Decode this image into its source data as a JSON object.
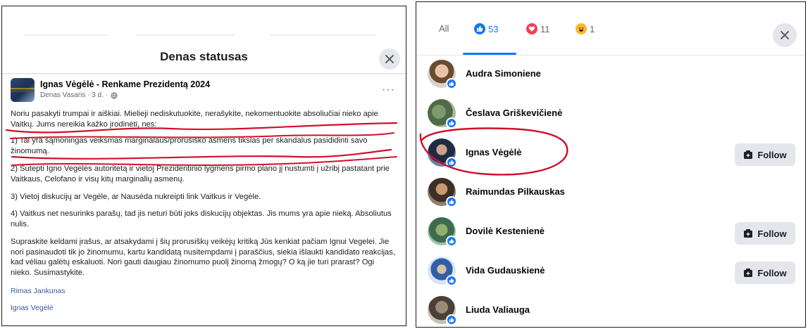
{
  "left": {
    "dialog_title": "Denas statusas",
    "post": {
      "author": "Ignas Vėgėlė - Renkame Prezidentą 2024",
      "meta": "Denas Vasaris · 3 d. ·",
      "paragraphs": [
        "Noriu pasakyti trumpai ir aiškiai. Mielieji nediskutuokite, nerašykite, nekomentuokite absoliučiai nieko apie Vaitkų. Jums nereikia kažko įrodinėti, nes:",
        "1) Tai yra sąmoningas veiksmas marginalaus/prorusiško asmens tikslas per skandalus pasididinti savo žinomumą.",
        "2) Sutepti Igno Vegėlės autoritetą ir vietoj Prezidentinio lygmens pirmo plano jį nustumti į užribį pastatant prie Vaitkaus, Celofano ir visų kitų marginalių asmenų.",
        "3) Vietoj diskucijų ar Vegėle, ar Nausėda nukreipti link Vaitkus ir Vegėle.",
        "4) Vaitkus net nesurinks parašų, tad jis neturi būti joks diskucijų objektas. Jis mums yra apie nieką. Absoliutus nulis.",
        "Supraskite keldami įrašus, ar atsakydami į šių prorusiškų veikėjų kritiką Jūs kenkiat pačiam Ignui Vegelei. Jie nori pasinaudoti tik jo žinomumu, kartu kandidatą nusitempdami į paraščius, siekia išlaukti kandidato reakcijas, kad vėliau galėtų eskaluoti. Nori gauti daugiau žinomumo puolį žinomą žmogų? O ką jie turi prarast? Ogi nieko. Susimastykite."
      ],
      "tag_links": [
        "Rimas Jankunas",
        "Ignas Vegėlė"
      ]
    },
    "icons": {
      "close": "close-icon",
      "globe": "globe-icon",
      "more": "more-icon"
    }
  },
  "right": {
    "tabs": [
      {
        "label": "All",
        "icon": ""
      },
      {
        "label": "53",
        "icon": "like-icon"
      },
      {
        "label": "11",
        "icon": "love-icon"
      },
      {
        "label": "1",
        "icon": "haha-icon"
      }
    ],
    "people": [
      {
        "name": "Audra Simoniene",
        "follow": ""
      },
      {
        "name": "Česlava Griškevičienė",
        "follow": ""
      },
      {
        "name": "Ignas Vėgėlė",
        "follow": "Follow"
      },
      {
        "name": "Raimundas Pilkauskas",
        "follow": ""
      },
      {
        "name": "Dovilė Kestenienė",
        "follow": "Follow"
      },
      {
        "name": "Vida Gudauskienė",
        "follow": "Follow"
      },
      {
        "name": "Liuda Valiauga",
        "follow": ""
      }
    ],
    "colors": {
      "accent": "#1877f2",
      "love": "#f33e58",
      "haha": "#f7b928",
      "annotation": "#d0102a"
    }
  }
}
